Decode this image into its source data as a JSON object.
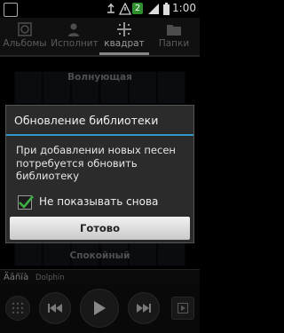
{
  "status_bar": {
    "time": "1:00",
    "notification_count": "2"
  },
  "tabs": [
    {
      "label": "Альбомы",
      "icon": "album-icon"
    },
    {
      "label": "Исполнит",
      "icon": "artist-icon"
    },
    {
      "label": "квадрат",
      "icon": "music-square-icon",
      "active": true
    },
    {
      "label": "Папки",
      "icon": "folder-icon"
    }
  ],
  "mood_square": {
    "top_label": "Волнующая",
    "bottom_label": "Спокойный"
  },
  "dialog": {
    "title": "Обновление библиотеки",
    "message": "При добавлении новых песен потребуется обновить библиотеку",
    "checkbox_label": "Не показывать снова",
    "checkbox_checked": true,
    "button_label": "Готово"
  },
  "now_playing": {
    "title": "Äāñïà",
    "artist": "Dolphin"
  },
  "colors": {
    "accent": "#2f97c9",
    "check": "#3cb043"
  }
}
